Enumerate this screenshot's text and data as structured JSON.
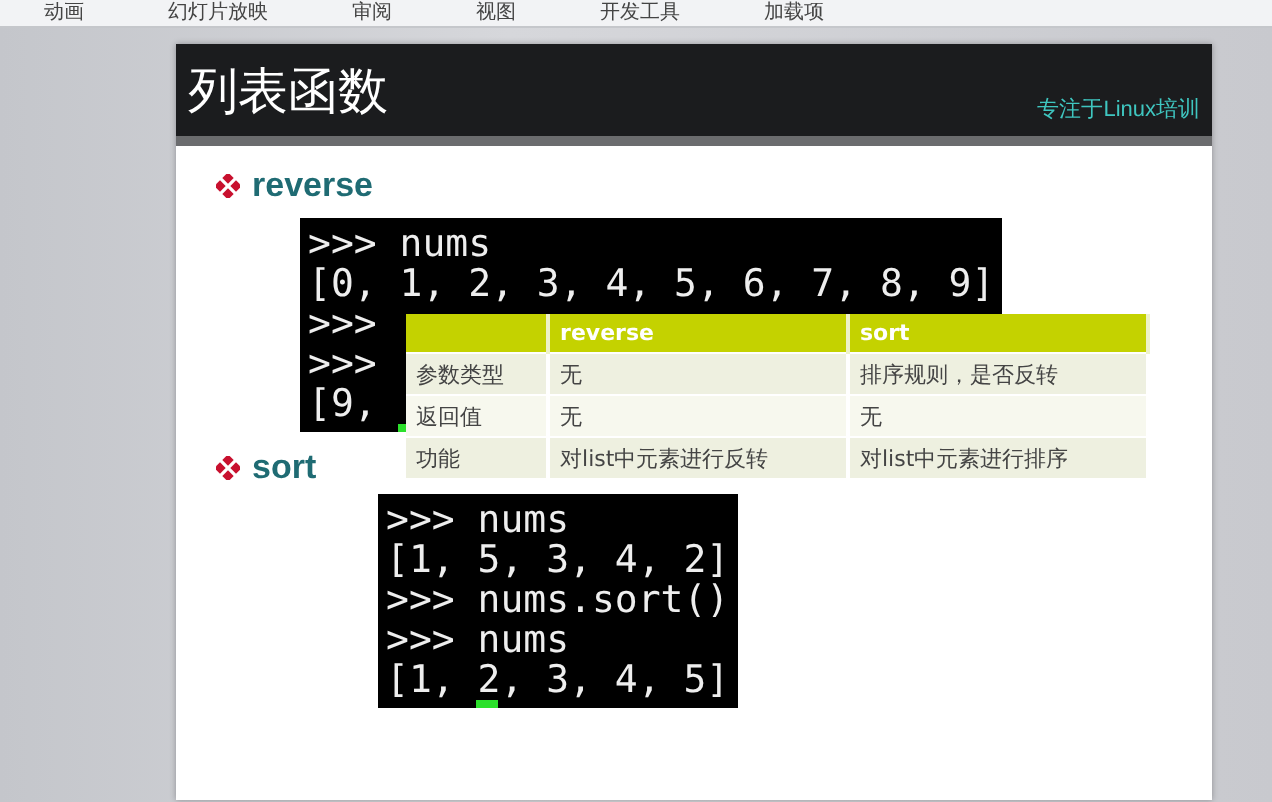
{
  "ribbon_tabs": [
    "动画",
    "幻灯片放映",
    "审阅",
    "视图",
    "开发工具",
    "加载项"
  ],
  "slide": {
    "title": "列表函数",
    "tagline": "专注于Linux培训",
    "sections": [
      {
        "heading": "reverse",
        "terminal": [
          ">>> nums",
          "[0, 1, 2, 3, 4, 5, 6, 7, 8, 9]",
          ">>>",
          ">>>",
          "[9,"
        ],
        "cursor": true,
        "table": {
          "columns": [
            "",
            "reverse",
            "sort"
          ],
          "rows": [
            [
              "参数类型",
              "无",
              "排序规则，是否反转"
            ],
            [
              "返回值",
              "无",
              "无"
            ],
            [
              "功能",
              "对list中元素进行反转",
              "对list中元素进行排序"
            ]
          ]
        }
      },
      {
        "heading": "sort",
        "terminal": [
          ">>> nums",
          "[1, 5, 3, 4, 2]",
          ">>> nums.sort()",
          ">>> nums",
          "[1, 2, 3, 4, 5]"
        ],
        "cursor": true
      }
    ]
  }
}
